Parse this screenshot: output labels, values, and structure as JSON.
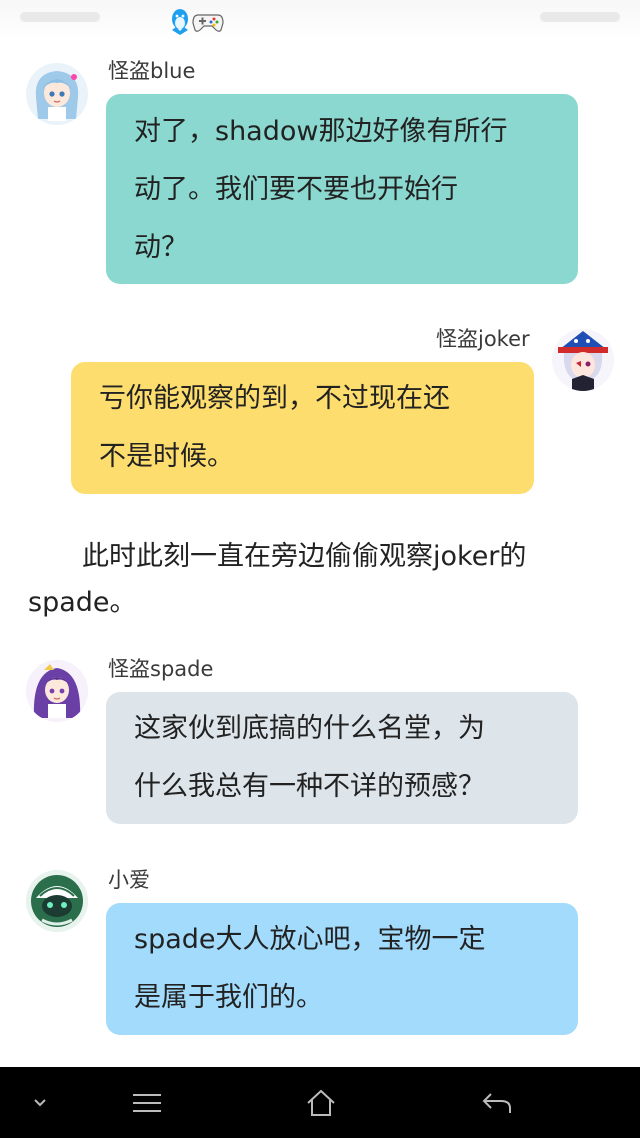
{
  "messages": [
    {
      "sender": "怪盗blue",
      "side": "left",
      "bubble_color": "#8ad8cf",
      "lines": [
        "对了，shadow那边好像有所行",
        "动了。我们要不要也开始行",
        "动？"
      ]
    },
    {
      "sender": "怪盗joker",
      "side": "right",
      "bubble_color": "#fddd6e",
      "lines": [
        "亏你能观察的到，不过现在还",
        "不是时候。"
      ]
    },
    {
      "sender": "怪盗spade",
      "side": "left",
      "bubble_color": "#dde4ea",
      "lines": [
        "这家伙到底搞的什么名堂，为",
        "什么我总有一种不详的预感？"
      ]
    },
    {
      "sender": "小爱",
      "side": "left",
      "bubble_color": "#a2dbfb",
      "lines": [
        "spade大人放心吧，宝物一定",
        "是属于我们的。"
      ]
    }
  ],
  "narration": {
    "lines": [
      "　　此时此刻一直在旁边偷偷观察joker的",
      "spade。"
    ]
  },
  "status_icons": [
    "qq-penguin-icon",
    "gamepad-icon"
  ],
  "nav": [
    "chevron-down-icon",
    "menu-icon",
    "home-icon",
    "back-icon"
  ]
}
